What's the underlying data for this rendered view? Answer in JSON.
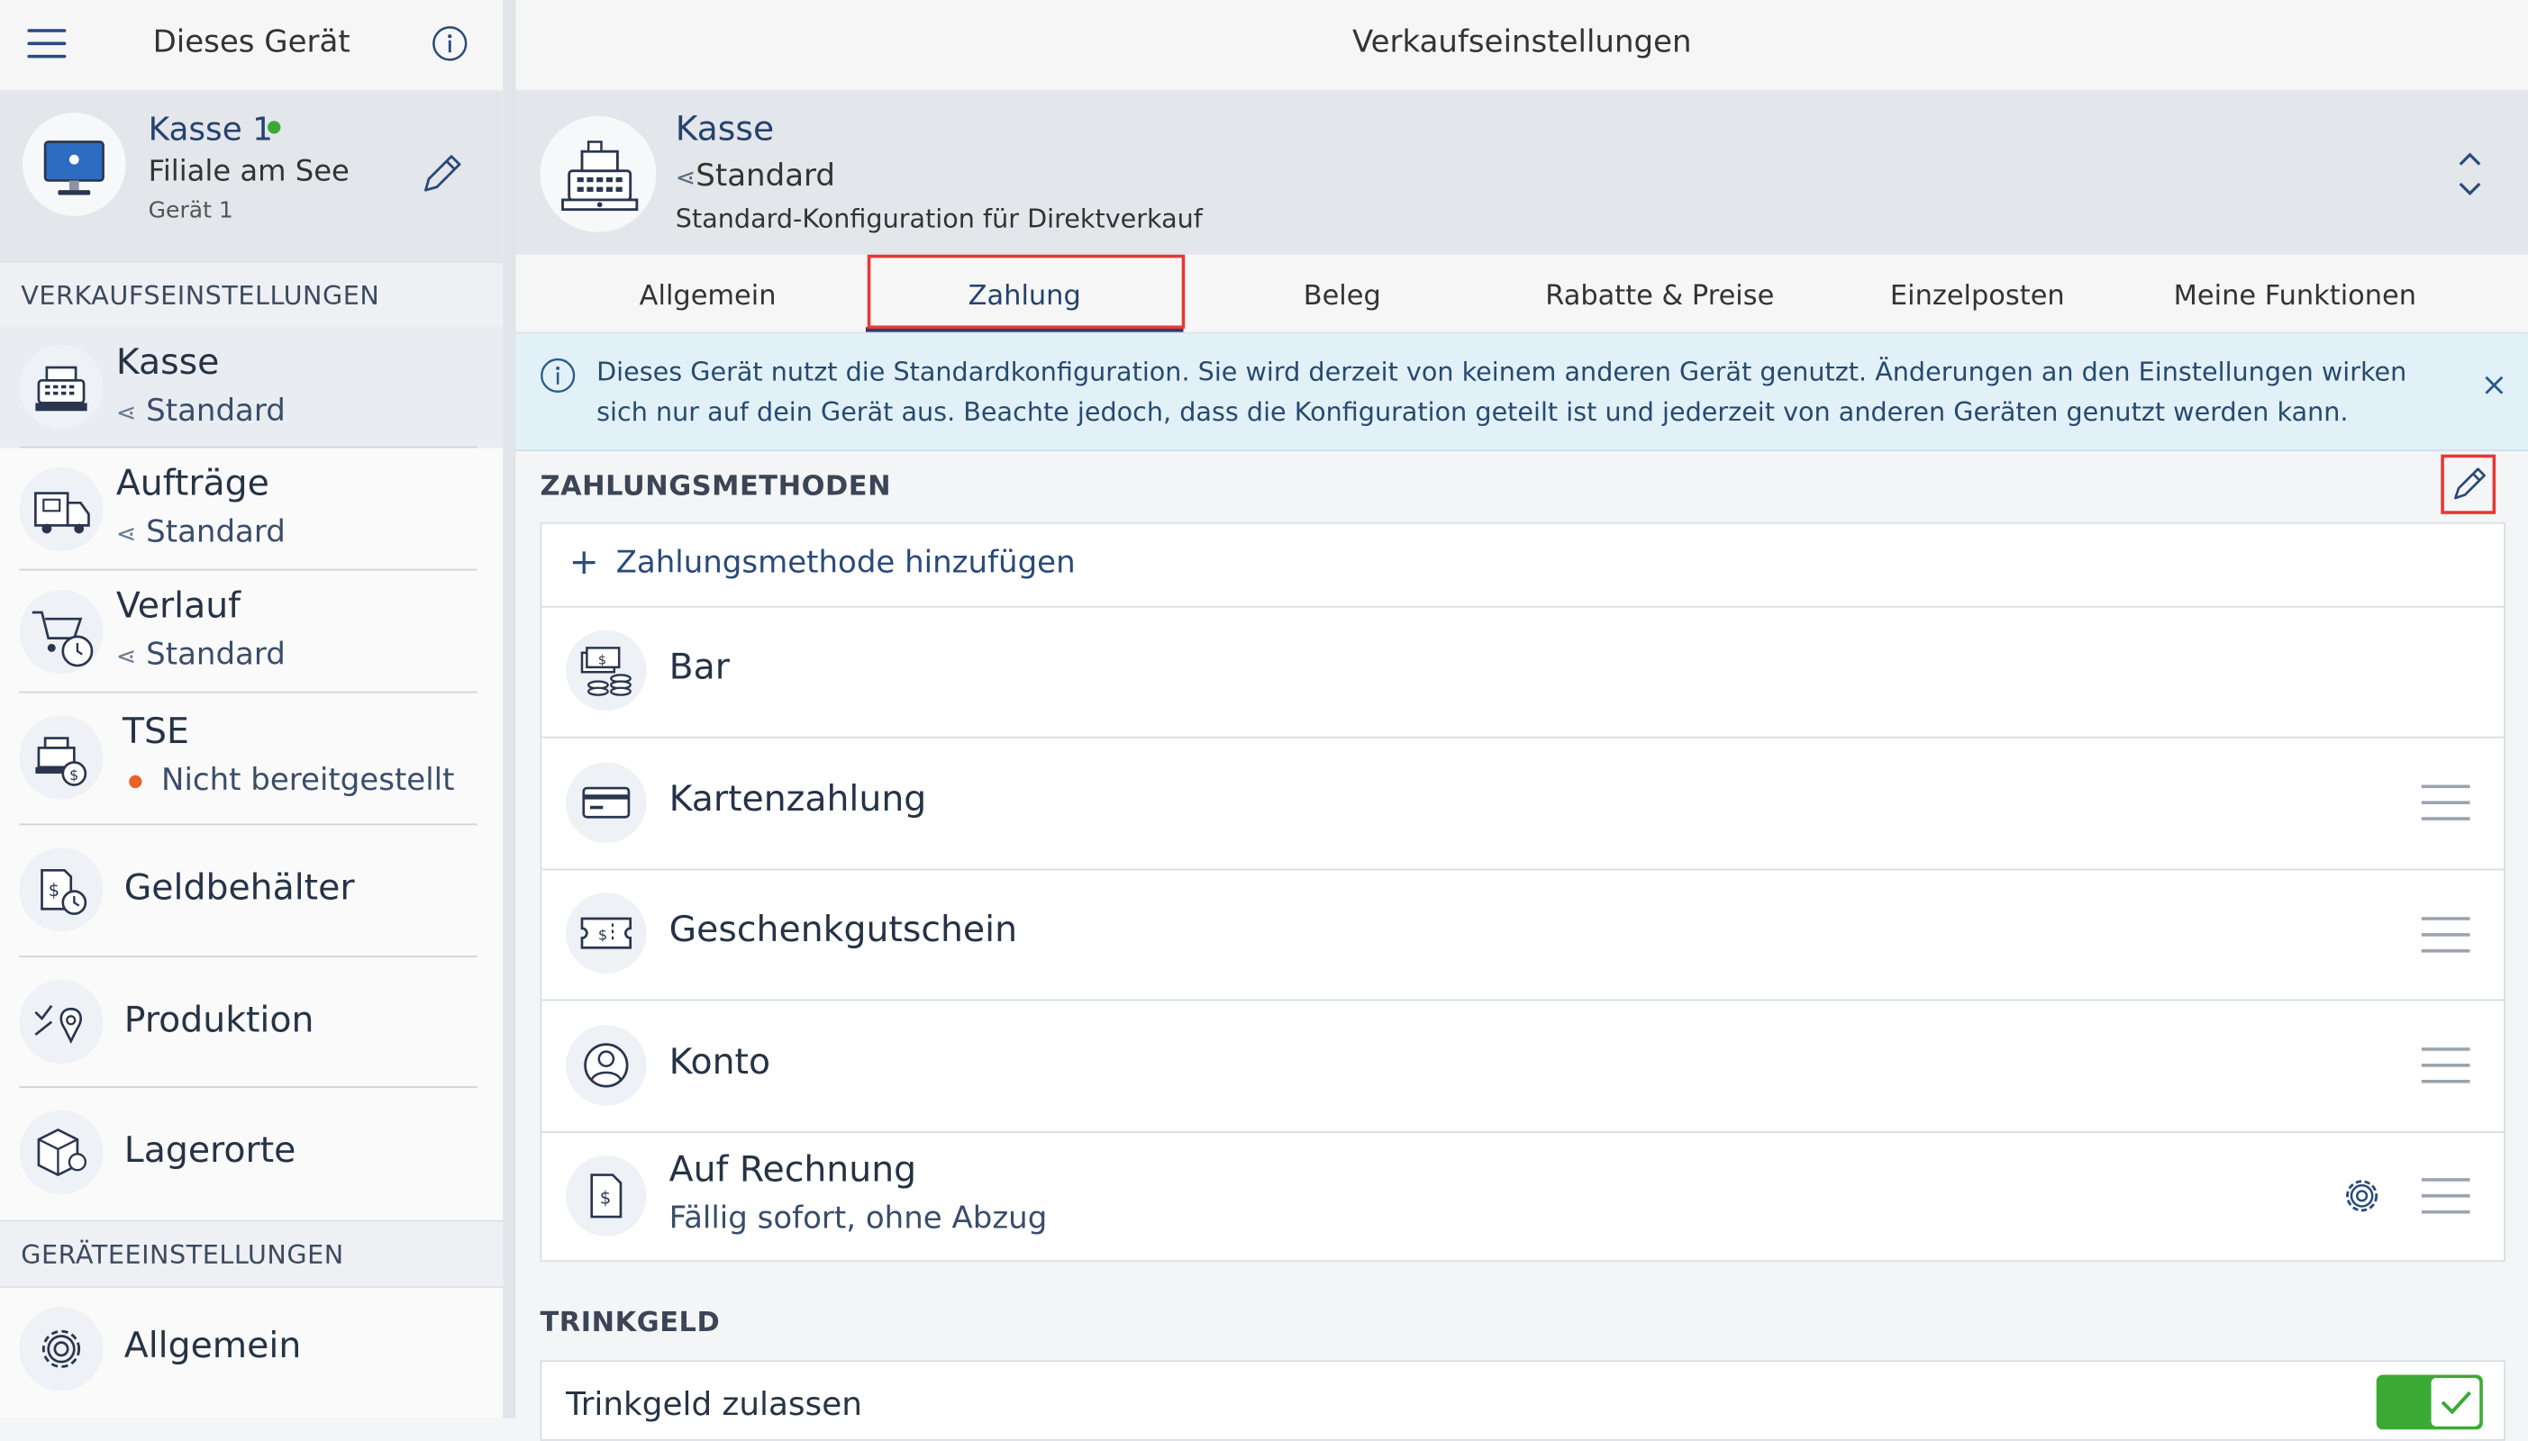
{
  "sidebar": {
    "title": "Dieses Gerät",
    "device": {
      "name": "Kasse 1",
      "branch": "Filiale am See",
      "sub": "Gerät 1",
      "status_color": "#3aaa35"
    },
    "section_sales": "VERKAUFSEINSTELLUNGEN",
    "items": [
      {
        "label": "Kasse",
        "sub": "Standard"
      },
      {
        "label": "Aufträge",
        "sub": "Standard"
      },
      {
        "label": "Verlauf",
        "sub": "Standard"
      },
      {
        "label": "TSE",
        "sub": "Nicht bereitgestellt"
      },
      {
        "label": "Geldbehälter"
      },
      {
        "label": "Produktion"
      },
      {
        "label": "Lagerorte"
      }
    ],
    "section_device": "GERÄTEEINSTELLUNGEN",
    "device_items": [
      {
        "label": "Allgemein"
      }
    ]
  },
  "main": {
    "title": "Verkaufseinstellungen",
    "config": {
      "name": "Kasse",
      "profile": "Standard",
      "description": "Standard-Konfiguration für Direktverkauf"
    },
    "tabs": [
      {
        "label": "Allgemein"
      },
      {
        "label": "Zahlung",
        "selected": true
      },
      {
        "label": "Beleg"
      },
      {
        "label": "Rabatte & Preise"
      },
      {
        "label": "Einzelposten"
      },
      {
        "label": "Meine Funktionen"
      }
    ],
    "banner": "Dieses Gerät nutzt die Standardkonfiguration. Sie wird derzeit von keinem anderen Gerät genutzt. Änderungen an den Einstellungen wirken sich nur auf dein Gerät aus. Beachte jedoch, dass die Konfiguration geteilt ist und jederzeit von anderen Geräten genutzt werden kann.",
    "payment_section": "ZAHLUNGSMETHODEN",
    "add_payment": "Zahlungsmethode hinzufügen",
    "payments": [
      {
        "label": "Bar",
        "icon": "cash-icon"
      },
      {
        "label": "Kartenzahlung",
        "icon": "card-icon"
      },
      {
        "label": "Geschenkgutschein",
        "icon": "voucher-icon"
      },
      {
        "label": "Konto",
        "icon": "account-icon"
      },
      {
        "label": "Auf Rechnung",
        "sub": "Fällig sofort, ohne Abzug",
        "icon": "invoice-icon"
      }
    ],
    "tip_section": "TRINKGELD",
    "tip_label": "Trinkgeld zulassen",
    "tip_enabled": true
  },
  "colors": {
    "accent": "#24426e",
    "highlight": "#e53935",
    "toggle_on": "#3aaa35",
    "banner_bg": "#e1f1f7"
  }
}
